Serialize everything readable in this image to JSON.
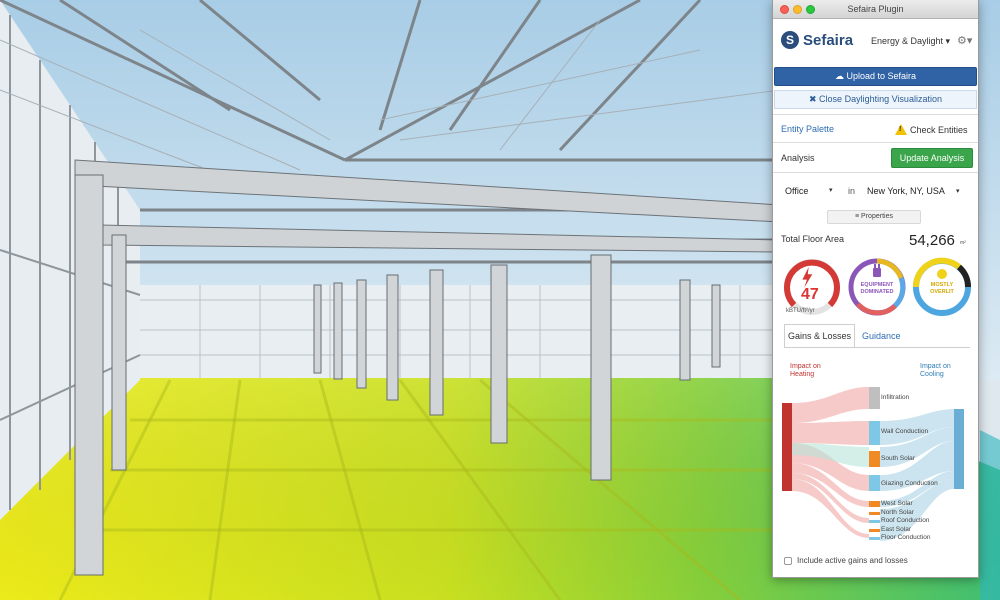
{
  "window": {
    "title": "Sefaira Plugin"
  },
  "brand": {
    "logo_letter": "S",
    "name": "Sefaira",
    "mode": "Energy & Daylight ▾",
    "gear": "⚙▾"
  },
  "actions": {
    "upload_label": "☁ Upload to Sefaira",
    "close_viz_label": "✖ Close Daylighting Visualization",
    "entity_palette": "Entity Palette",
    "check_entities": "Check Entities",
    "analysis": "Analysis",
    "update_analysis": "Update Analysis"
  },
  "building": {
    "type": "Office",
    "in_word": "in",
    "location": "New York, NY, USA",
    "caret": "▾",
    "properties": "≡ Properties"
  },
  "floor_area": {
    "label": "Total Floor Area",
    "value": "54,266",
    "unit": "m²"
  },
  "metrics": {
    "eui": {
      "value": "47",
      "unit": "kBTU/ft²/yr",
      "color": "#d33a36"
    },
    "equipment": {
      "text": "EQUIPMENT DOMINATED",
      "color": "#8a57b8"
    },
    "daylight": {
      "text": "MOSTLY OVERLIT",
      "color": "#f0d21b"
    }
  },
  "tabs": {
    "gains": "Gains & Losses",
    "guidance": "Guidance"
  },
  "sankey": {
    "heating_label": "Impact on Heating",
    "cooling_label": "Impact on Cooling",
    "items": [
      {
        "label": "Infiltration",
        "color": "#bfbfbf"
      },
      {
        "label": "Wall Conduction",
        "color": "#7fc7e6"
      },
      {
        "label": "South Solar",
        "color": "#f08a24"
      },
      {
        "label": "Glazing Conduction",
        "color": "#7fc7e6"
      },
      {
        "label": "West Solar",
        "color": "#f08a24"
      },
      {
        "label": "North Solar",
        "color": "#f08a24"
      },
      {
        "label": "Roof Conduction",
        "color": "#7fc7e6"
      },
      {
        "label": "East Solar",
        "color": "#f08a24"
      },
      {
        "label": "Floor Conduction",
        "color": "#7fc7e6"
      }
    ],
    "heating_color": "#c0332f",
    "cooling_color": "#6aaed6"
  },
  "options": {
    "include_active": "Include active gains and losses"
  }
}
